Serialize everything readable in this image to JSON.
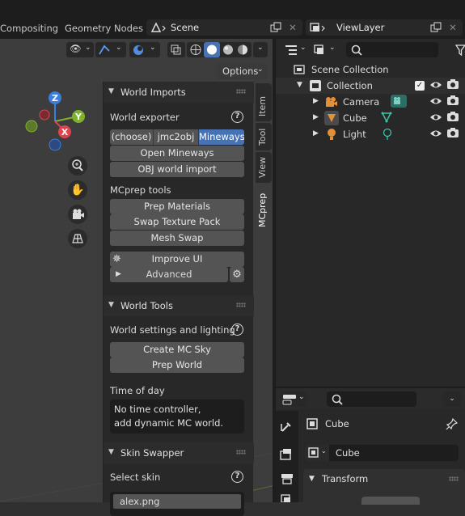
{
  "topbar": {
    "workspace_tabs": [
      "Compositing",
      "Geometry Nodes"
    ],
    "scene_name": "Scene",
    "view_layer_name": "ViewLayer"
  },
  "viewport": {
    "options_label": "Options"
  },
  "n_panel": {
    "tabs": [
      "Item",
      "Tool",
      "View",
      "MCprep"
    ],
    "active_tab": "MCprep",
    "world_imports": {
      "title": "World Imports",
      "exporter_label": "World exporter",
      "exporter_options": [
        "(choose)",
        "jmc2obj",
        "Mineways"
      ],
      "exporter_selected": "Mineways",
      "open_mineways": "Open Mineways",
      "obj_world_import": "OBJ world import",
      "mcprep_tools_label": "MCprep tools",
      "prep_materials": "Prep Materials",
      "swap_texture_pack": "Swap Texture Pack",
      "mesh_swap": "Mesh Swap",
      "improve_ui": "Improve UI",
      "advanced": "Advanced"
    },
    "world_tools": {
      "title": "World Tools",
      "settings_label": "World settings and lighting",
      "create_mc_sky": "Create MC Sky",
      "prep_world": "Prep World",
      "time_of_day_label": "Time of day",
      "time_line1": "No time controller,",
      "time_line2": "add dynamic MC world."
    },
    "skin_swapper": {
      "title": "Skin Swapper",
      "select_skin_label": "Select skin",
      "skin_item": "alex.png"
    }
  },
  "outliner": {
    "scene_collection": "Scene Collection",
    "collection": "Collection",
    "items": [
      {
        "name": "Camera",
        "icon": "camera-icon"
      },
      {
        "name": "Cube",
        "icon": "mesh-icon"
      },
      {
        "name": "Light",
        "icon": "light-icon"
      }
    ]
  },
  "properties": {
    "object_name": "Cube",
    "data_name": "Cube",
    "transform_label": "Transform"
  },
  "colors": {
    "accent": "#4772b3",
    "axis_x": "#e2424d",
    "axis_y": "#7fb22c",
    "axis_z": "#3a7ee0"
  }
}
